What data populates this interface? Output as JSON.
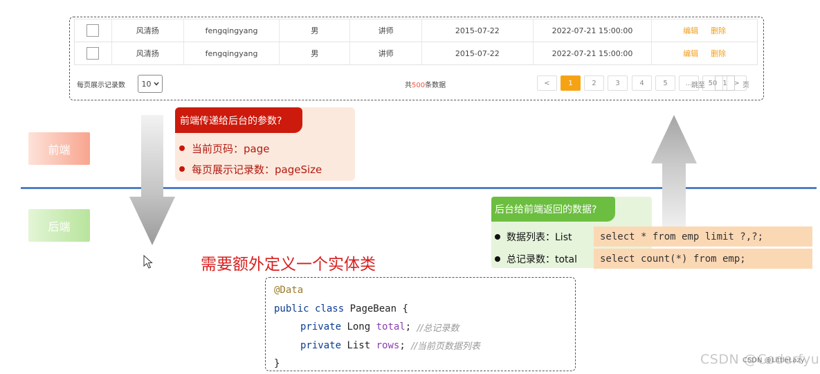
{
  "table": {
    "rows": [
      {
        "name": "风清扬",
        "username": "fengqingyang",
        "gender": "男",
        "job": "讲师",
        "entry_date": "2015-07-22",
        "update_time": "2022-07-21 15:00:00",
        "edit": "编辑",
        "delete": "删除"
      },
      {
        "name": "风清扬",
        "username": "fengqingyang",
        "gender": "男",
        "job": "讲师",
        "entry_date": "2015-07-22",
        "update_time": "2022-07-21 15:00:00",
        "edit": "编辑",
        "delete": "删除"
      }
    ],
    "pager": {
      "page_size_label": "每页展示记录数",
      "page_size_value": "10",
      "total_prefix": "共",
      "total_count": "500",
      "total_suffix": "条数据",
      "prev": "<",
      "pages": [
        "1",
        "2",
        "3",
        "4",
        "5",
        "...",
        "50"
      ],
      "current_page": "1",
      "next": ">",
      "goto_label": "跳至",
      "goto_value": "1",
      "goto_unit": "页"
    }
  },
  "labels": {
    "frontend": "前端",
    "backend": "后端"
  },
  "param_callout": {
    "title": "前端传递给后台的参数?",
    "items": [
      "当前页码：page",
      "每页展示记录数：pageSize"
    ]
  },
  "return_callout": {
    "title": "后台给前端返回的数据?",
    "items": [
      "数据列表：List",
      "总记录数：total"
    ]
  },
  "sql": [
    "select * from emp limit ?,?;",
    "select count(*) from emp;"
  ],
  "note": "需要额外定义一个实体类",
  "code": {
    "annotation": "@Data",
    "line1_kw": "public class",
    "line1_rest": " PageBean {",
    "line2_kw": "private",
    "line2_type": " Long ",
    "line2_field": "total",
    "line2_semicolon": "; ",
    "line2_comment": "//总记录数",
    "line3_kw": "private",
    "line3_type": " List ",
    "line3_field": "rows",
    "line3_semicolon": "; ",
    "line3_comment": "//当前页数据列表",
    "close": "}"
  },
  "watermark": "CSDN @Coderfyu",
  "watermark_small": "CSDN @LittleLazy",
  "colors": {
    "accent_orange": "#f6a313",
    "front_red": "#cc1a0c",
    "back_green": "#6cbe40",
    "divider_blue": "#4f80c6"
  }
}
